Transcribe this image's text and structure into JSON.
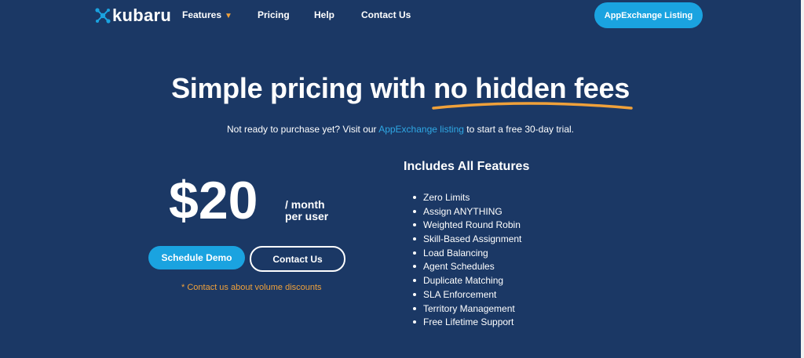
{
  "header": {
    "logo_text": "kubaru",
    "nav": [
      {
        "label": "Features",
        "has_dropdown": true
      },
      {
        "label": "Pricing"
      },
      {
        "label": "Help"
      },
      {
        "label": "Contact Us"
      }
    ],
    "cta_label": "AppExchange Listing"
  },
  "hero": {
    "headline_plain": "Simple pricing with ",
    "headline_accent": "no hidden fees",
    "sub_before": "Not ready to purchase yet? Visit our ",
    "sub_link": "AppExchange listing",
    "sub_after": " to start a free 30-day trial."
  },
  "pricing": {
    "price": "$20",
    "unit_line1": "/ month",
    "unit_line2": "per user",
    "demo_button": "Schedule Demo",
    "contact_button": "Contact Us",
    "discount_note": "* Contact us about volume discounts"
  },
  "features": {
    "title": "Includes All Features",
    "items": [
      "Zero Limits",
      "Assign ANYTHING",
      "Weighted Round Robin",
      "Skill-Based Assignment",
      "Load Balancing",
      "Agent Schedules",
      "Duplicate Matching",
      "SLA Enforcement",
      "Territory Management",
      "Free Lifetime Support"
    ]
  },
  "colors": {
    "background": "#1b3865",
    "accent_blue": "#1aa3e0",
    "accent_orange": "#f0a13a"
  }
}
